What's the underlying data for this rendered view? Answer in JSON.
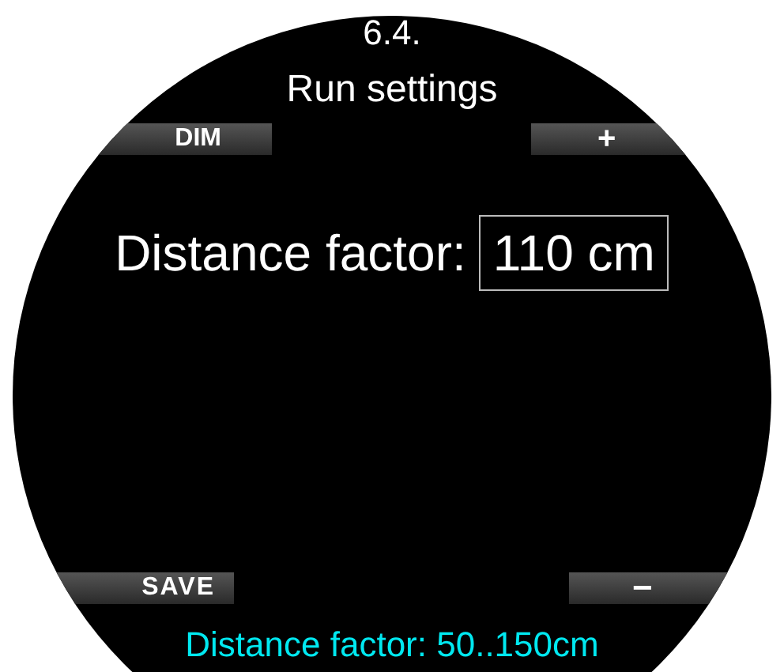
{
  "screen": {
    "section": "6.4.",
    "title": "Run settings",
    "top_keys": [
      {
        "label": "DIM"
      },
      {
        "label": "+"
      }
    ],
    "setting": {
      "label": "Distance factor:",
      "value": "110 cm"
    },
    "bottom_keys": [
      {
        "label": "SAVE"
      },
      {
        "label": "−"
      }
    ],
    "hint": "Distance factor: 50..150cm"
  }
}
